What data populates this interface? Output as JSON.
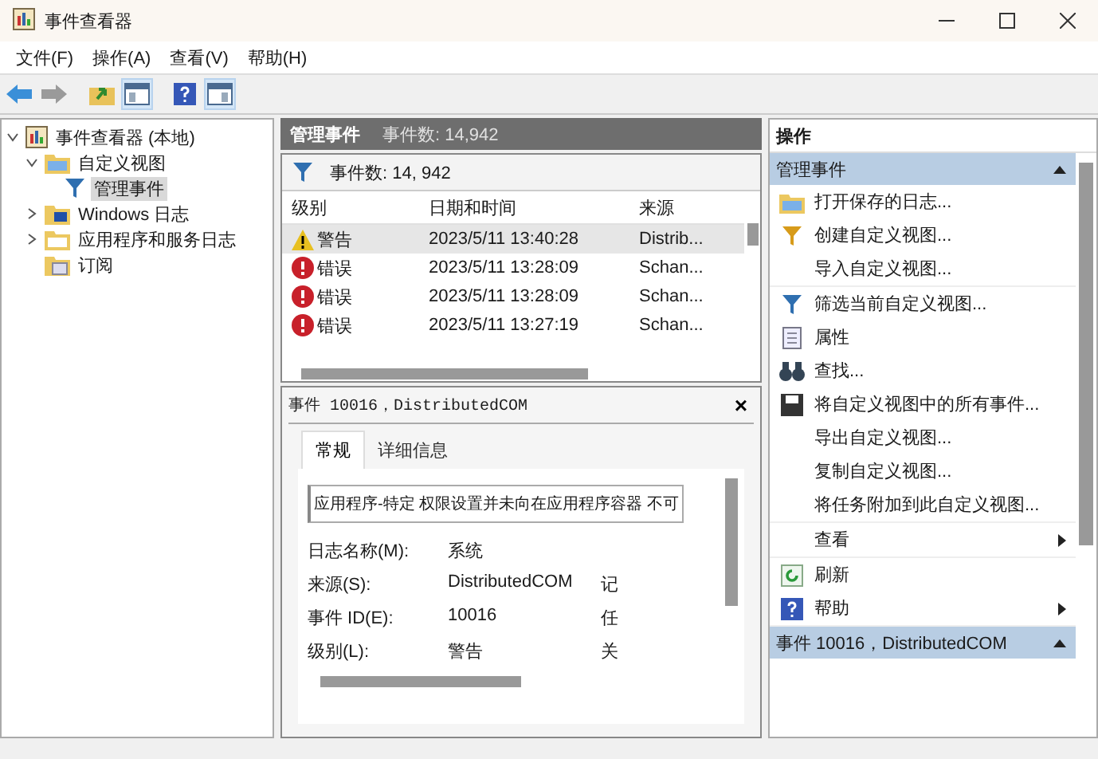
{
  "window": {
    "title": "事件查看器"
  },
  "menu": [
    "文件(F)",
    "操作(A)",
    "查看(V)",
    "帮助(H)"
  ],
  "toolbar": [
    {
      "kind": "back",
      "pressed": false
    },
    {
      "kind": "forward",
      "pressed": false
    },
    {
      "kind": "up",
      "pressed": false
    },
    {
      "kind": "tree",
      "pressed": true
    },
    {
      "kind": "help",
      "pressed": false
    },
    {
      "kind": "pane",
      "pressed": true
    }
  ],
  "tree": [
    {
      "label": "事件查看器 (本地)",
      "kind": "root",
      "expanded": true,
      "selected": false,
      "children": [
        {
          "label": "自定义视图",
          "kind": "folder",
          "expanded": true,
          "selected": false,
          "children": [
            {
              "label": "管理事件",
              "kind": "filter",
              "selected": true
            }
          ]
        },
        {
          "label": "Windows 日志",
          "kind": "winlog",
          "expanded": false,
          "selected": false
        },
        {
          "label": "应用程序和服务日志",
          "kind": "folder-plain",
          "expanded": false,
          "selected": false
        },
        {
          "label": "订阅",
          "kind": "subscription",
          "selected": false
        }
      ]
    }
  ],
  "center": {
    "title": "管理事件",
    "count": "事件数: 14,942",
    "filter_count": "事件数: 14, 942",
    "table": {
      "columns": [
        "级别",
        "日期和时间",
        "来源"
      ],
      "rows": [
        {
          "kind": "warning",
          "level": "警告",
          "datetime": "2023/5/11 13:40:28",
          "source": "Distrib...",
          "selected": true
        },
        {
          "kind": "error",
          "level": "错误",
          "datetime": "2023/5/11 13:28:09",
          "source": "Schan...",
          "selected": false
        },
        {
          "kind": "error",
          "level": "错误",
          "datetime": "2023/5/11 13:28:09",
          "source": "Schan...",
          "selected": false
        },
        {
          "kind": "error",
          "level": "错误",
          "datetime": "2023/5/11 13:27:19",
          "source": "Schan...",
          "selected": false
        }
      ]
    },
    "detail": {
      "title": "事件 10016，DistributedCOM",
      "close": "×",
      "tabs": [
        {
          "label": "常规",
          "selected": true
        },
        {
          "label": "详细信息",
          "selected": false
        }
      ],
      "description": "应用程序-特定 权限设置并未向在应用程序容器 不可",
      "fields": [
        {
          "label": "日志名称(M):",
          "value": "系统"
        },
        {
          "label": "来源(S):",
          "value": "DistributedCOM",
          "column_3": "记"
        },
        {
          "label": "事件 ID(E):",
          "value": "10016",
          "column_3": "任"
        },
        {
          "label": "级别(L):",
          "value": "警告",
          "column_3": "关"
        }
      ]
    }
  },
  "actions": {
    "title": "操作",
    "sections": [
      {
        "title": "管理事件",
        "expanded": true,
        "groups": [
          [
            {
              "label": "打开保存的日志...",
              "kind": "folder",
              "submenu": false
            },
            {
              "label": "创建自定义视图...",
              "kind": "filter-gold",
              "submenu": false
            },
            {
              "label": "导入自定义视图...",
              "kind": "plain",
              "submenu": false
            }
          ],
          [
            {
              "label": "筛选当前自定义视图...",
              "kind": "filter",
              "submenu": false
            },
            {
              "label": "属性",
              "kind": "sheet",
              "submenu": false
            },
            {
              "label": "查找...",
              "kind": "binoculars",
              "submenu": false
            },
            {
              "label": "将自定义视图中的所有事件...",
              "kind": "disk",
              "submenu": false
            },
            {
              "label": "导出自定义视图...",
              "kind": "plain",
              "submenu": false
            },
            {
              "label": "复制自定义视图...",
              "kind": "plain",
              "submenu": false
            },
            {
              "label": "将任务附加到此自定义视图...",
              "kind": "plain",
              "submenu": false
            }
          ],
          [
            {
              "label": "查看",
              "kind": "plain",
              "submenu": true
            }
          ],
          [
            {
              "label": "刷新",
              "kind": "refresh",
              "submenu": false
            },
            {
              "label": "帮助",
              "kind": "help",
              "submenu": true
            }
          ]
        ]
      },
      {
        "title": "事件 10016，DistributedCOM",
        "expanded": true
      }
    ]
  }
}
